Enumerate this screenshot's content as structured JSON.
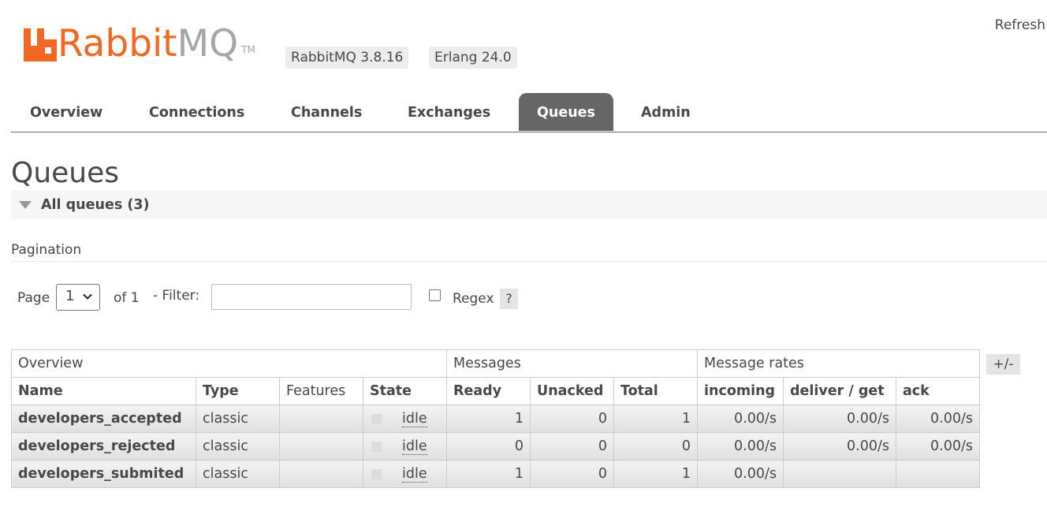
{
  "header": {
    "logo_rabbit": "Rabbit",
    "logo_mq": "MQ",
    "logo_tm": "TM",
    "rabbitmq_version": "RabbitMQ 3.8.16",
    "erlang_version": "Erlang 24.0",
    "refresh_label": "Refresh"
  },
  "nav": {
    "tabs": [
      {
        "label": "Overview",
        "active": false
      },
      {
        "label": "Connections",
        "active": false
      },
      {
        "label": "Channels",
        "active": false
      },
      {
        "label": "Exchanges",
        "active": false
      },
      {
        "label": "Queues",
        "active": true
      },
      {
        "label": "Admin",
        "active": false
      }
    ]
  },
  "page": {
    "title": "Queues",
    "section_title": "All queues (3)",
    "pagination_label": "Pagination"
  },
  "filter": {
    "page_label": "Page",
    "page_value": "1",
    "of_label": "of 1",
    "filter_label": "- Filter:",
    "filter_value": "",
    "regex_label": "Regex",
    "regex_checked": false,
    "help_label": "?"
  },
  "table": {
    "groups": [
      "Overview",
      "Messages",
      "Message rates"
    ],
    "columns": [
      "Name",
      "Type",
      "Features",
      "State",
      "Ready",
      "Unacked",
      "Total",
      "incoming",
      "deliver / get",
      "ack"
    ],
    "columns_toggle": "+/-",
    "rows": [
      {
        "name": "developers_accepted",
        "type": "classic",
        "features": "",
        "state": "idle",
        "ready": "1",
        "unacked": "0",
        "total": "1",
        "incoming": "0.00/s",
        "deliver_get": "0.00/s",
        "ack": "0.00/s"
      },
      {
        "name": "developers_rejected",
        "type": "classic",
        "features": "",
        "state": "idle",
        "ready": "0",
        "unacked": "0",
        "total": "0",
        "incoming": "0.00/s",
        "deliver_get": "0.00/s",
        "ack": "0.00/s"
      },
      {
        "name": "developers_submited",
        "type": "classic",
        "features": "",
        "state": "idle",
        "ready": "1",
        "unacked": "0",
        "total": "1",
        "incoming": "0.00/s",
        "deliver_get": "",
        "ack": ""
      }
    ]
  },
  "colors": {
    "brand_orange": "#f26722",
    "logo_gray": "#a6a6a6",
    "active_tab": "#666666",
    "text": "#484848"
  }
}
